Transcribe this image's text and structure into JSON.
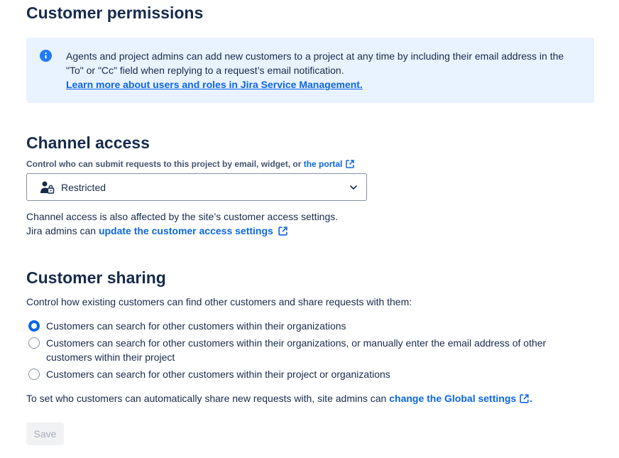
{
  "customer_permissions": {
    "title": "Customer permissions",
    "info": {
      "text": "Agents and project admins can add new customers to a project at any time by including their email address in the \"To\" or \"Cc\" field when replying to a request’s email notification.",
      "link": "Learn more about users and roles in Jira Service Management."
    }
  },
  "channel_access": {
    "title": "Channel access",
    "label_prefix": "Control who can submit requests to this project by email, widget, or ",
    "label_link": "the portal",
    "select_value": "Restricted",
    "note_line1": "Channel access is also affected by the site’s customer access settings.",
    "note_line2_prefix": "Jira admins can ",
    "note_line2_link": "update the customer access settings"
  },
  "customer_sharing": {
    "title": "Customer sharing",
    "description": "Control how existing customers can find other customers and share requests with them:",
    "options": [
      {
        "label": "Customers can search for other customers within their organizations",
        "selected": true
      },
      {
        "label": "Customers can search for other customers within their organizations, or manually enter the email address of other customers within their project",
        "selected": false
      },
      {
        "label": "Customers can search for other customers within their project or organizations",
        "selected": false
      }
    ],
    "footer_prefix": "To set who customers can automatically share new requests with, site admins can ",
    "footer_link": "change the Global settings",
    "footer_suffix": "."
  },
  "save_label": "Save",
  "colors": {
    "link": "#0c66e4",
    "info_bg": "#e9f2ff",
    "text": "#172b4d",
    "radio_selected": "#0c66e4"
  },
  "icons": {
    "info": "info-icon",
    "external_link": "external-link-icon",
    "restricted": "user-lock-icon",
    "chevron": "chevron-down-icon"
  }
}
